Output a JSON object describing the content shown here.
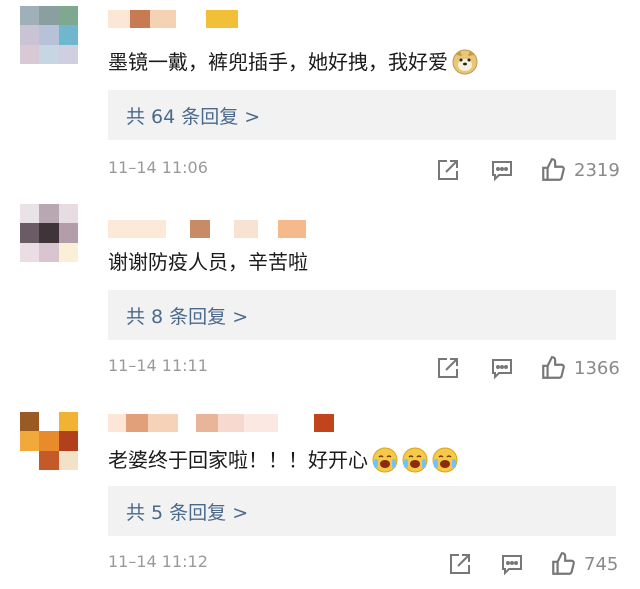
{
  "comments": [
    {
      "text": "墨镜一戴，裤兜插手，她好拽，我好爱",
      "emoji": "doge-icon",
      "replies": "共 64 条回复 >",
      "time": "11–14 11:06",
      "likes": "2319"
    },
    {
      "text": "谢谢防疫人员，辛苦啦",
      "emoji": "",
      "replies": "共 8 条回复 >",
      "time": "11–14 11:11",
      "likes": "1366"
    },
    {
      "text": "老婆终于回家啦！！！好开心",
      "emoji": "tearful-joy-icon",
      "replies": "共 5 条回复 >",
      "time": "11–14 11:12",
      "likes": "745"
    }
  ],
  "colors": {
    "reply_link": "#4b6a8b",
    "meta": "#9a9a9a",
    "reply_bg": "#f2f2f2"
  }
}
